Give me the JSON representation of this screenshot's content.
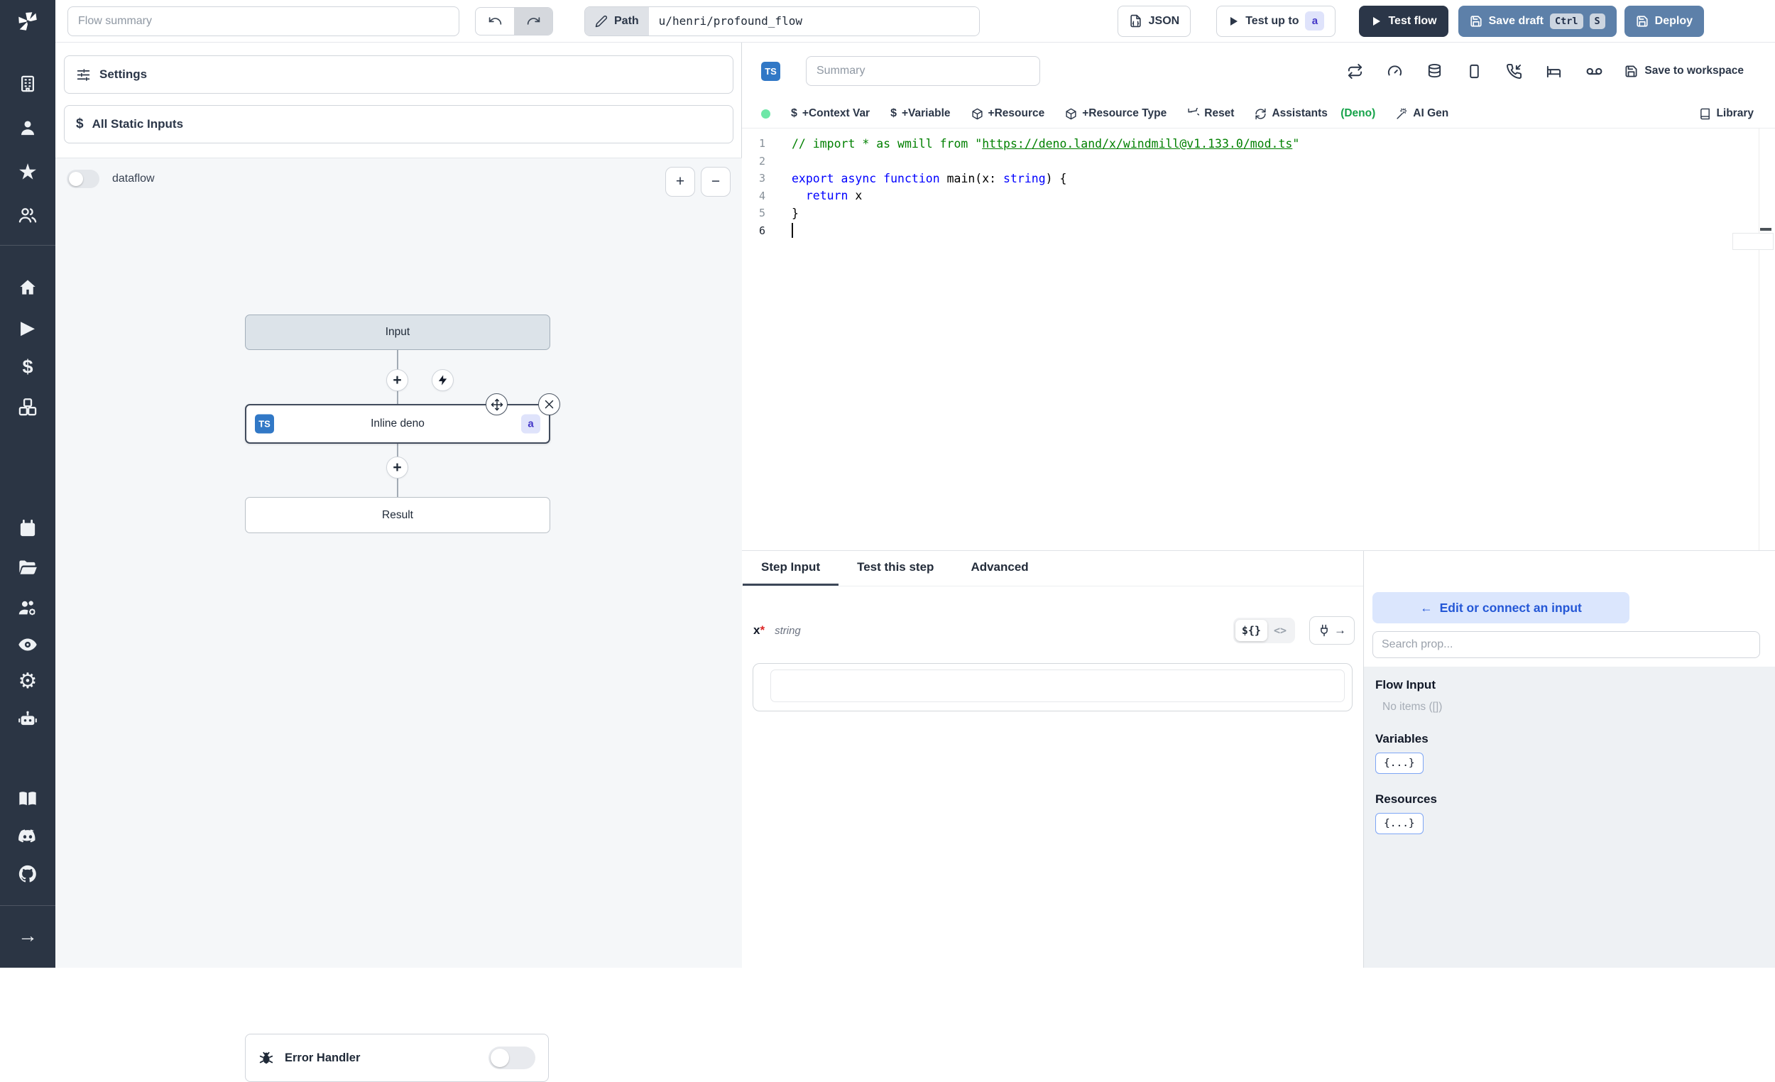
{
  "topbar": {
    "flow_summary_placeholder": "Flow summary",
    "path_label": "Path",
    "path_value": "u/henri/profound_flow",
    "json_label": "JSON",
    "test_up_to_label": "Test up to",
    "test_up_to_badge": "a",
    "test_flow_label": "Test flow",
    "save_draft_label": "Save draft",
    "save_draft_kbd": [
      "Ctrl",
      "S"
    ],
    "deploy_label": "Deploy"
  },
  "flow_panel": {
    "settings_label": "Settings",
    "static_inputs_label": "All Static Inputs",
    "dataflow_label": "dataflow",
    "dataflow_enabled": false,
    "graph": {
      "input_node": "Input",
      "step_node": {
        "lang_badge": "TS",
        "label": "Inline deno",
        "suffix_badge": "a"
      },
      "result_node": "Result"
    },
    "error_handler_label": "Error Handler",
    "error_handler_enabled": false
  },
  "editor": {
    "lang_badge": "TS",
    "summary_placeholder": "Summary",
    "save_to_workspace_label": "Save to workspace",
    "actions": {
      "context_var": "+Context Var",
      "variable": "+Variable",
      "resource": "+Resource",
      "resource_type": "+Resource Type",
      "reset": "Reset",
      "assistants": "Assistants",
      "assistants_lang": "(Deno)",
      "ai_gen": "AI Gen",
      "library": "Library"
    },
    "code": {
      "lines": [
        {
          "n": "1",
          "tokens": [
            {
              "t": "// import * as wmill from \"",
              "c": "tok-comment"
            },
            {
              "t": "https://deno.land/x/windmill@v1.133.0/mod.ts",
              "c": "tok-comment tok-link"
            },
            {
              "t": "\"",
              "c": "tok-comment"
            }
          ]
        },
        {
          "n": "2",
          "tokens": []
        },
        {
          "n": "3",
          "tokens": [
            {
              "t": "export",
              "c": "tok-kw"
            },
            {
              "t": " ",
              "c": "tok-plain"
            },
            {
              "t": "async",
              "c": "tok-kw"
            },
            {
              "t": " ",
              "c": "tok-plain"
            },
            {
              "t": "function",
              "c": "tok-kw"
            },
            {
              "t": " main(x: ",
              "c": "tok-plain"
            },
            {
              "t": "string",
              "c": "tok-kw"
            },
            {
              "t": ") {",
              "c": "tok-plain"
            }
          ]
        },
        {
          "n": "4",
          "tokens": [
            {
              "t": "  ",
              "c": "tok-plain"
            },
            {
              "t": "return",
              "c": "tok-kw"
            },
            {
              "t": " x",
              "c": "tok-plain"
            }
          ]
        },
        {
          "n": "5",
          "tokens": [
            {
              "t": "}",
              "c": "tok-plain"
            }
          ]
        },
        {
          "n": "6",
          "tokens": [],
          "cursor": true
        }
      ]
    }
  },
  "step_panel": {
    "tabs": [
      {
        "label": "Step Input"
      },
      {
        "label": "Test this step"
      },
      {
        "label": "Advanced"
      }
    ],
    "arg": {
      "name": "x",
      "required": "*",
      "type": "string",
      "value": "",
      "toggle_template": "${}",
      "toggle_code": "<>"
    }
  },
  "connect_panel": {
    "back_button_label": "Edit or connect an input",
    "search_placeholder": "Search prop...",
    "flow_input_title": "Flow Input",
    "flow_input_empty": "No items ([])",
    "variables_title": "Variables",
    "variables_chip": "{...}",
    "resources_title": "Resources",
    "resources_chip": "{...}"
  },
  "icons": {
    "plus": "+",
    "minus": "−",
    "star": "★",
    "play": "▶",
    "gear": "⚙",
    "dollar": "$",
    "arrow_right": "→",
    "left_arrow": "←",
    "close": "✕"
  },
  "colors": {
    "sidebar_bg": "#2b3544",
    "primary_button_bg": "#5d80a9",
    "dark_button_bg": "#2b3648",
    "ts_badge_bg": "#3178c6",
    "badge_indigo_bg": "#dfe3fb",
    "badge_indigo_text": "#4437c8",
    "link_blue": "#2457d6",
    "green_dot": "#6ee7a7",
    "deno_green": "#16a34a",
    "code_keyword": "#0000ff",
    "code_comment": "#008000",
    "graph_bg": "#f5f7f9"
  }
}
